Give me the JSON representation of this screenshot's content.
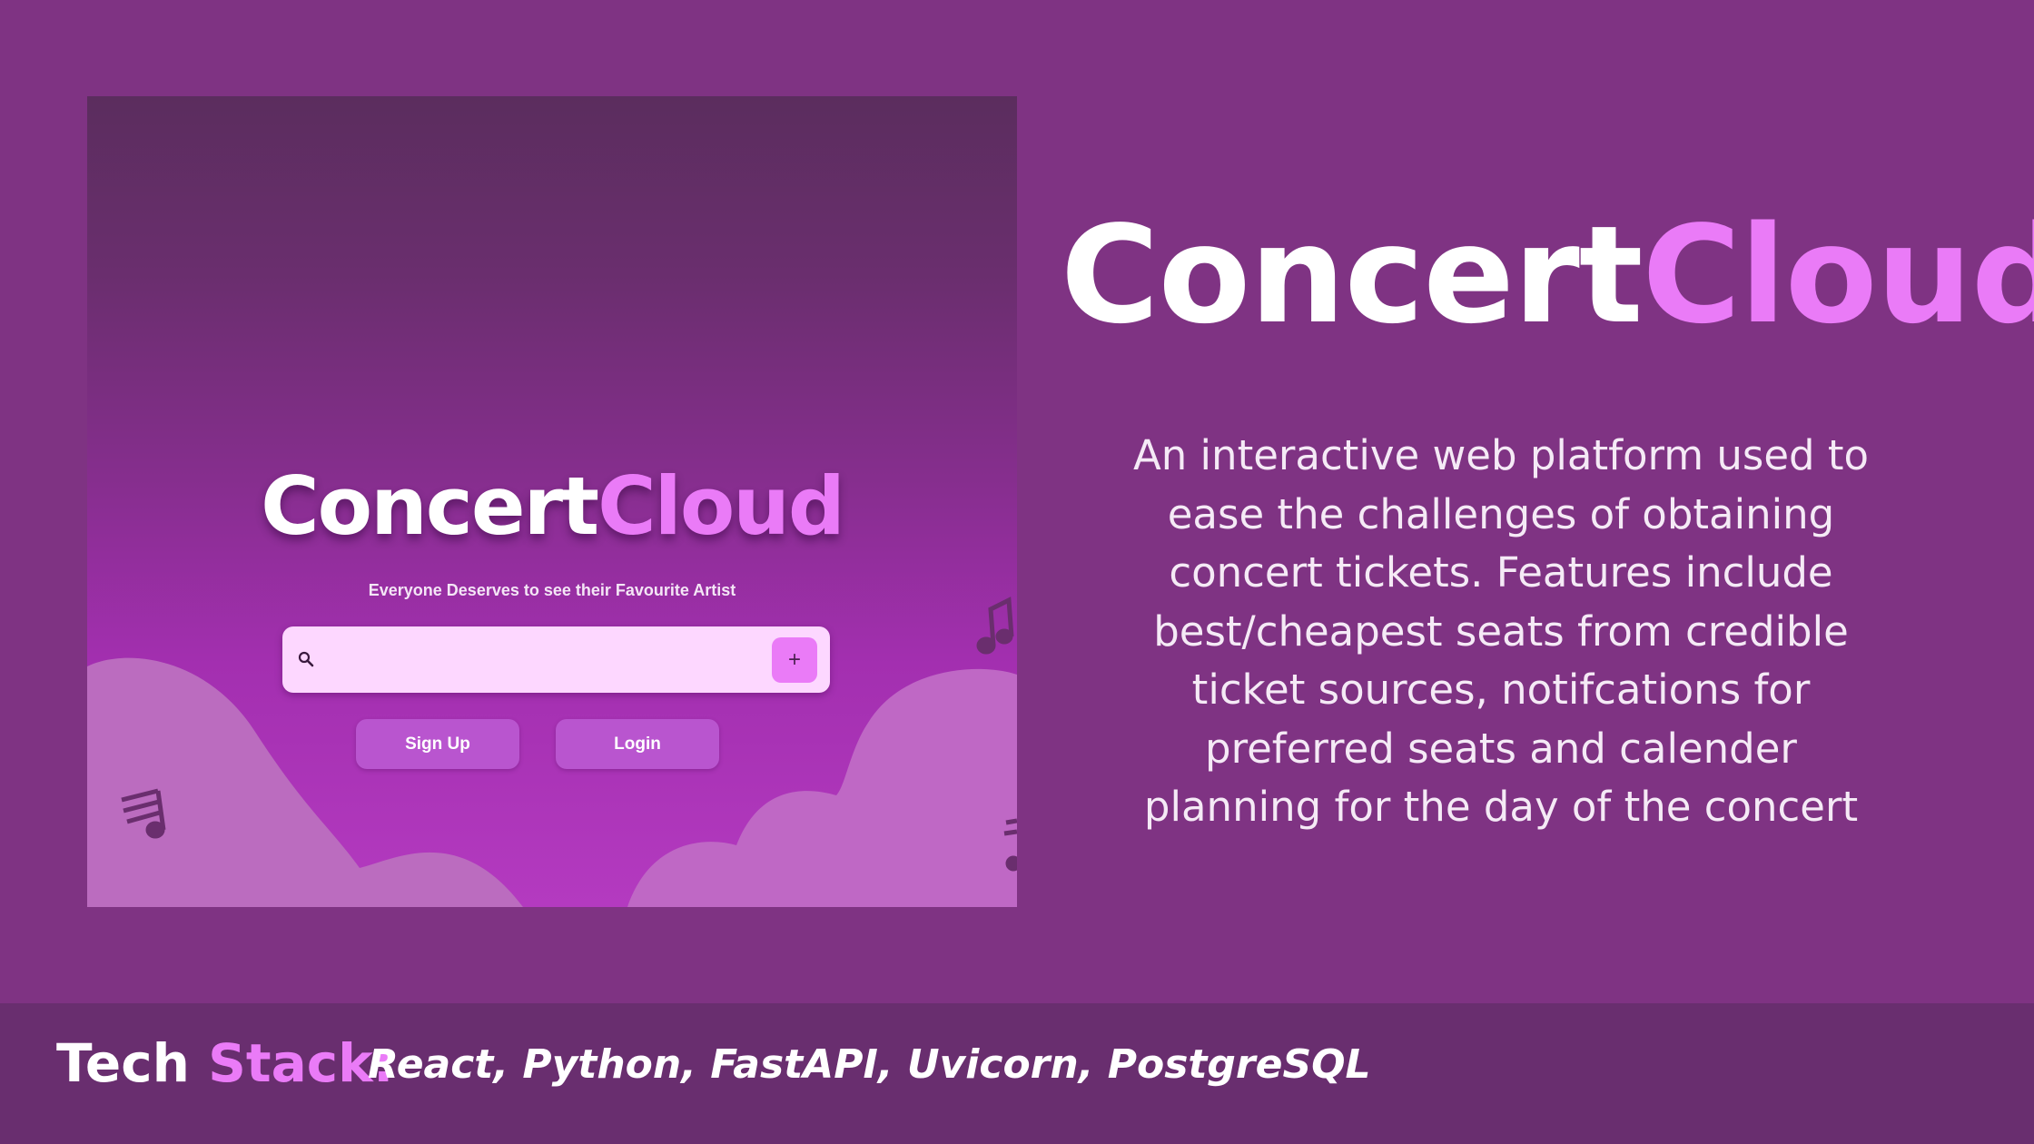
{
  "screenshot": {
    "title_part1": "Concert",
    "title_part2": "Cloud",
    "subtitle": "Everyone Deserves to see their Favourite Artist",
    "search": {
      "placeholder": "",
      "add_label": "+"
    },
    "buttons": {
      "signup_label": "Sign Up",
      "login_label": "Login"
    }
  },
  "hero": {
    "title_part1": "Concert",
    "title_part2": "Cloud",
    "description_lines": [
      "An interactive web platform used to",
      "ease the challenges of obtaining",
      "concert tickets. Features include",
      "best/cheapest seats from credible",
      "ticket sources, notifcations for",
      "preferred seats and calender",
      "planning for the day of the concert"
    ]
  },
  "footer": {
    "label_part1": "Tech",
    "label_part2": "Stack:",
    "stack": "React, Python, FastAPI, Uvicorn, PostgreSQL"
  },
  "colors": {
    "background": "#7f3383",
    "accent": "#ea7bf7",
    "footer_bg": "#692e6f",
    "search_bg": "#fdd7ff",
    "button_bg": "#b955cf"
  },
  "icons": [
    "search-icon",
    "plus-icon",
    "music-note-icon"
  ]
}
